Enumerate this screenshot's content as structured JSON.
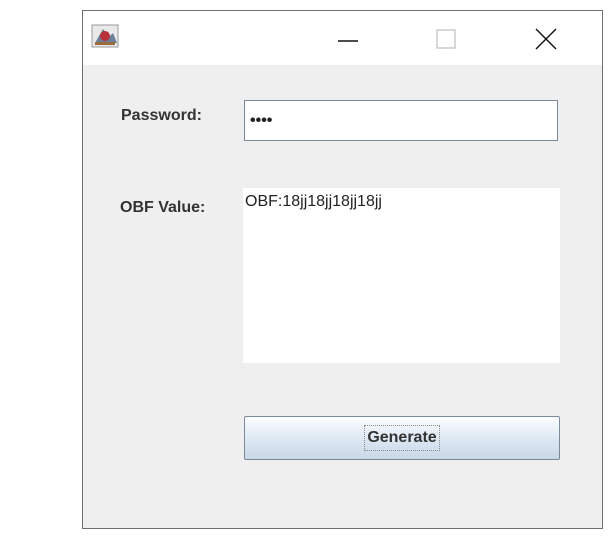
{
  "window": {
    "title": "",
    "icons": {
      "app": "java-app-icon",
      "minimize": "minimize-icon",
      "maximize": "maximize-icon",
      "close": "close-icon"
    }
  },
  "form": {
    "password_label": "Password:",
    "password_value": "••••",
    "obf_label": "OBF Value:",
    "obf_value": "OBF:18jj18jj18jj18jj",
    "generate_label": "Generate"
  },
  "colors": {
    "window_bg": "#efefef",
    "titlebar_bg": "#ffffff",
    "button_gradient_top": "#fdfeff",
    "button_gradient_bottom": "#c9d8e7"
  }
}
